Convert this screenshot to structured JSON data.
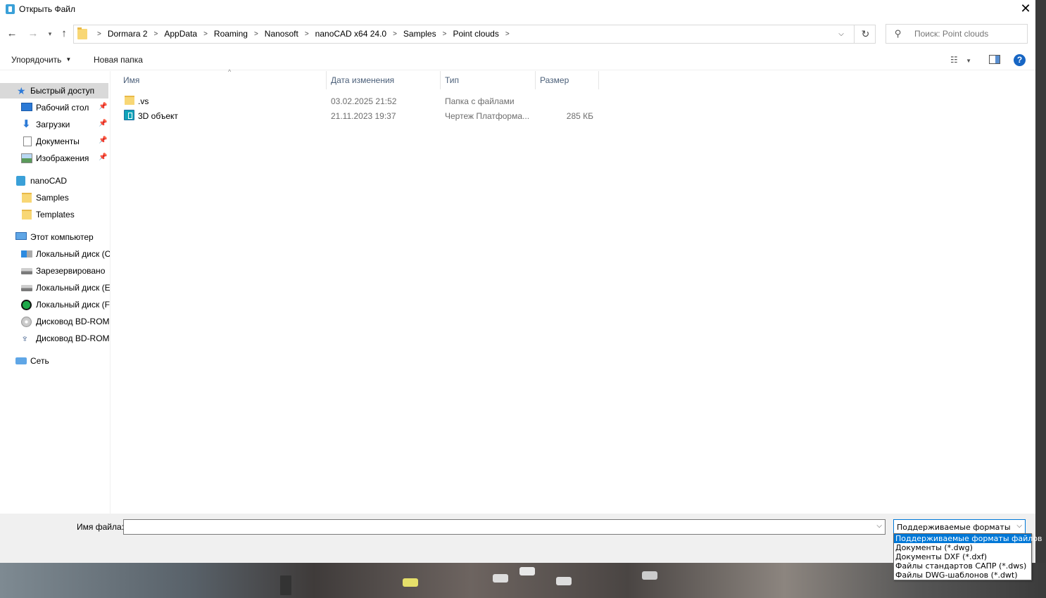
{
  "window": {
    "title": "Открыть Файл"
  },
  "breadcrumbs": [
    "Dormara 2",
    "AppData",
    "Roaming",
    "Nanosoft",
    "nanoCAD x64 24.0",
    "Samples",
    "Point clouds"
  ],
  "search": {
    "placeholder": "Поиск: Point clouds"
  },
  "toolbar": {
    "organize": "Упорядочить",
    "new_folder": "Новая папка"
  },
  "nav": {
    "quick_access": "Быстрый доступ",
    "desktop": "Рабочий стол",
    "downloads": "Загрузки",
    "documents": "Документы",
    "images": "Изображения",
    "nanocad": "nanoCAD",
    "samples": "Samples",
    "templates": "Templates",
    "this_pc": "Этот компьютер",
    "disk_c": "Локальный диск (C",
    "reserved": "Зарезервировано",
    "disk_e": "Локальный диск (E",
    "disk_f": "Локальный диск (F",
    "bd_rom1": "Дисковод BD-ROM",
    "bd_rom2": "Дисковод BD-ROM",
    "network": "Сеть"
  },
  "columns": {
    "name": "Имя",
    "date": "Дата изменения",
    "type": "Тип",
    "size": "Размер"
  },
  "files": [
    {
      "name": ".vs",
      "date": "03.02.2025 21:52",
      "type": "Папка с файлами",
      "size": ""
    },
    {
      "name": "3D объект",
      "date": "21.11.2023 19:37",
      "type": "Чертеж Платформа...",
      "size": "285 КБ"
    }
  ],
  "bottom": {
    "filename_label": "Имя файла:",
    "filename_value": "",
    "filetype_selected": "Поддерживаемые форматы фа",
    "filetype_options": [
      "Поддерживаемые форматы файлов",
      "Документы (*.dwg)",
      "Документы DXF (*.dxf)",
      "Файлы стандартов САПР (*.dws)",
      "Файлы DWG-шаблонов (*.dwt)"
    ]
  },
  "colors": {
    "accent": "#0078d7",
    "selected_nav": "#d9d9d9",
    "folder": "#f8d775"
  }
}
